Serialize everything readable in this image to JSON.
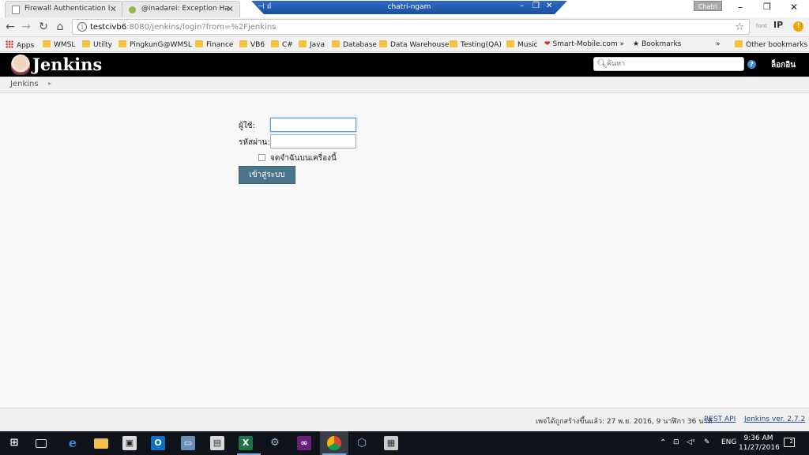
{
  "browser": {
    "tabs": [
      {
        "title": "Firewall Authentication I"
      },
      {
        "title": "@inadarei: Exception Ha"
      }
    ],
    "remote_session": {
      "title": "chatri-ngam"
    },
    "user_chip": "Chatri",
    "address": {
      "host": "testcivb6",
      "rest": ":8080/jenkins/login?from=%2Fjenkins"
    },
    "ext_labels": [
      "font",
      "IP"
    ],
    "bookmarks": [
      {
        "label": "Apps",
        "kind": "apps"
      },
      {
        "label": "WMSL",
        "kind": "folder"
      },
      {
        "label": "Utilty",
        "kind": "folder"
      },
      {
        "label": "PingkunG@WMSL",
        "kind": "folder"
      },
      {
        "label": "Finance",
        "kind": "folder"
      },
      {
        "label": "VB6",
        "kind": "folder"
      },
      {
        "label": "C#",
        "kind": "folder"
      },
      {
        "label": "Java",
        "kind": "folder"
      },
      {
        "label": "Database",
        "kind": "folder"
      },
      {
        "label": "Data Warehouse",
        "kind": "folder"
      },
      {
        "label": "Testing(QA)",
        "kind": "folder"
      },
      {
        "label": "Music",
        "kind": "folder"
      },
      {
        "label": "Smart-Mobile.com »",
        "kind": "site"
      },
      {
        "label": "Bookmarks",
        "kind": "star"
      },
      {
        "label": "Other bookmarks",
        "kind": "folder"
      }
    ],
    "bookmarks_overflow": "»"
  },
  "jenkins": {
    "logo": "Jenkins",
    "search_placeholder": "ค้นหา",
    "help": "?",
    "login_link": "ล็อกอิน",
    "breadcrumb": "Jenkins"
  },
  "login_form": {
    "username_label": "ผู้ใช้:",
    "password_label": "รหัสผ่าน:",
    "username_value": "",
    "password_value": "",
    "remember_label": "จดจำฉันบนเครื่องนี้",
    "submit_label": "เข้าสู่ระบบ"
  },
  "footer": {
    "generated": "เพจได้ถูกสร้างขึ้นแล้ว: 27 พ.ย. 2016, 9 นาฬิกา 36 นาที",
    "rest_api": "REST API",
    "version": "Jenkins ver. 2.7.2"
  },
  "taskbar": {
    "language": "ENG",
    "time": "9:36 AM",
    "date": "11/27/2016",
    "notifications": "2"
  }
}
